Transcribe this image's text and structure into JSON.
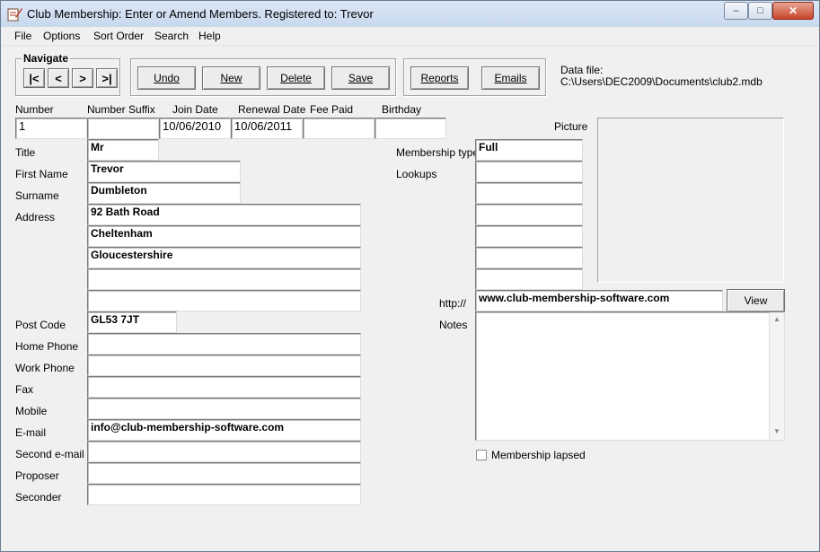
{
  "window": {
    "title": "Club Membership: Enter or Amend Members. Registered to: Trevor",
    "minimize_glyph": "‒",
    "maximize_glyph": "□",
    "close_glyph": "✕"
  },
  "menu": [
    "File",
    "Options",
    "Sort Order",
    "Search",
    "Help"
  ],
  "navigate": {
    "legend": "Navigate",
    "first": "|<",
    "prev": "<",
    "next": ">",
    "last": ">|"
  },
  "actions": {
    "undo": "Undo",
    "new": "New",
    "delete": "Delete",
    "save": "Save",
    "reports": "Reports",
    "emails": "Emails"
  },
  "datafile": {
    "label": "Data file:",
    "path": "C:\\Users\\DEC2009\\Documents\\club2.mdb"
  },
  "record": {
    "labels": {
      "number": "Number",
      "number_suffix": "Number Suffix",
      "join_date": "Join Date",
      "renewal_date": "Renewal Date",
      "fee_paid": "Fee Paid",
      "birthday": "Birthday",
      "picture": "Picture",
      "title": "Title",
      "first_name": "First Name",
      "surname": "Surname",
      "address": "Address",
      "post_code": "Post Code",
      "home_phone": "Home Phone",
      "work_phone": "Work Phone",
      "fax": "Fax",
      "mobile": "Mobile",
      "email": "E-mail",
      "second_email": "Second e-mail",
      "proposer": "Proposer",
      "seconder": "Seconder",
      "membership_type": "Membership type",
      "lookups": "Lookups",
      "http": "http://",
      "notes": "Notes",
      "lapsed": "Membership lapsed"
    },
    "values": {
      "number": "1",
      "number_suffix": "",
      "join_date": "10/06/2010",
      "renewal_date": "10/06/2011",
      "fee_paid": "",
      "birthday": "",
      "title": "Mr",
      "first_name": "Trevor",
      "surname": "Dumbleton",
      "address1": "92 Bath Road",
      "address2": "Cheltenham",
      "address3": "Gloucestershire",
      "address4": "",
      "address5": "",
      "post_code": "GL53 7JT",
      "home_phone": "",
      "work_phone": "",
      "fax": "",
      "mobile": "",
      "email": "info@club-membership-software.com",
      "second_email": "",
      "proposer": "",
      "seconder": "",
      "membership_type": "Full",
      "lookup1": "",
      "lookup2": "",
      "lookup3": "",
      "lookup4": "",
      "lookup5": "",
      "lookup6": "",
      "website": "www.club-membership-software.com",
      "notes": "",
      "lapsed_checked": false
    },
    "view_button": "View"
  },
  "scroll_glyphs": {
    "up": "▲",
    "down": "▼"
  }
}
